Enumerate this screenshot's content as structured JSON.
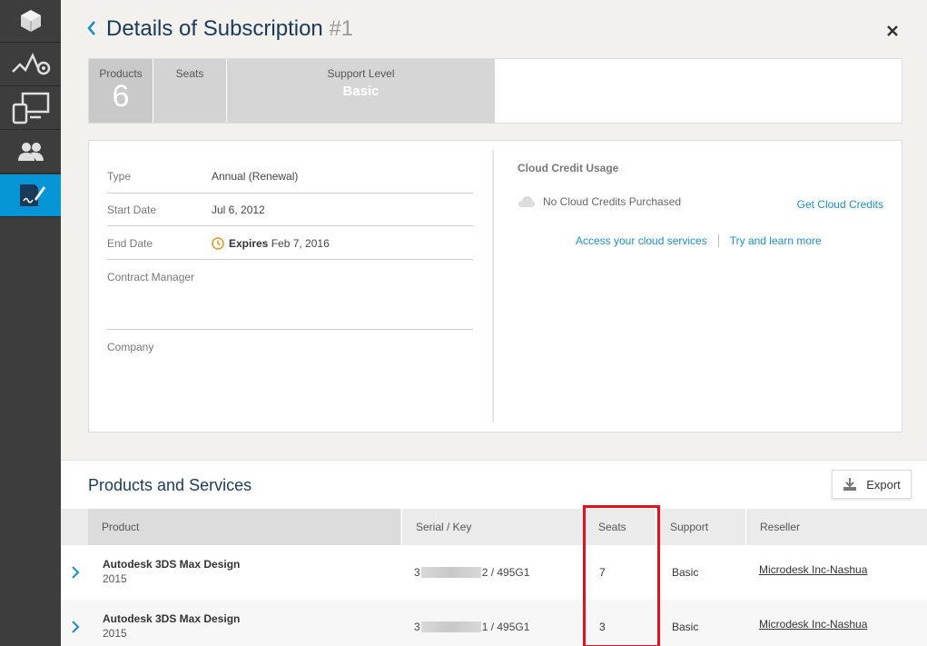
{
  "sidebar": {
    "items": [
      {
        "icon": "box-icon"
      },
      {
        "icon": "activity-chart-icon"
      },
      {
        "icon": "devices-icon"
      },
      {
        "icon": "users-icon"
      },
      {
        "icon": "contract-signature-icon",
        "active": true
      }
    ]
  },
  "header": {
    "title": "Details of Subscription",
    "number": "#1"
  },
  "summary": {
    "products_label": "Products",
    "products_value": "6",
    "seats_label": "Seats",
    "support_label": "Support Level",
    "support_value": "Basic"
  },
  "details": {
    "rows": [
      {
        "key": "Type",
        "value": "Annual (Renewal)"
      },
      {
        "key": "Start Date",
        "value": "Jul 6, 2012"
      },
      {
        "key": "End Date",
        "value_prefix": "Expires",
        "value": "Feb 7, 2016"
      },
      {
        "key": "Contract Manager",
        "value": ""
      },
      {
        "key": "Company",
        "value": ""
      }
    ]
  },
  "cloud": {
    "title": "Cloud Credit Usage",
    "status": "No Cloud Credits Purchased",
    "get_credits": "Get Cloud Credits",
    "access_link": "Access your cloud services",
    "try_link": "Try and learn more"
  },
  "products": {
    "title": "Products and Services",
    "export_label": "Export",
    "columns": [
      "Product",
      "Serial / Key",
      "Seats",
      "Support",
      "Reseller"
    ],
    "rows": [
      {
        "name": "Autodesk 3DS Max Design",
        "year": "2015",
        "serial_start": "3",
        "serial_end": "2 / 495G1",
        "seats": "7",
        "support": "Basic",
        "reseller": "Microdesk Inc-Nashua"
      },
      {
        "name": "Autodesk 3DS Max Design",
        "year": "2015",
        "serial_start": "3",
        "serial_end": "1 / 495G1",
        "seats": "3",
        "support": "Basic",
        "reseller": "Microdesk Inc-Nashua"
      }
    ]
  },
  "colors": {
    "accent": "#0696d7",
    "highlight": "#e3101f",
    "expires": "#e8931c"
  }
}
